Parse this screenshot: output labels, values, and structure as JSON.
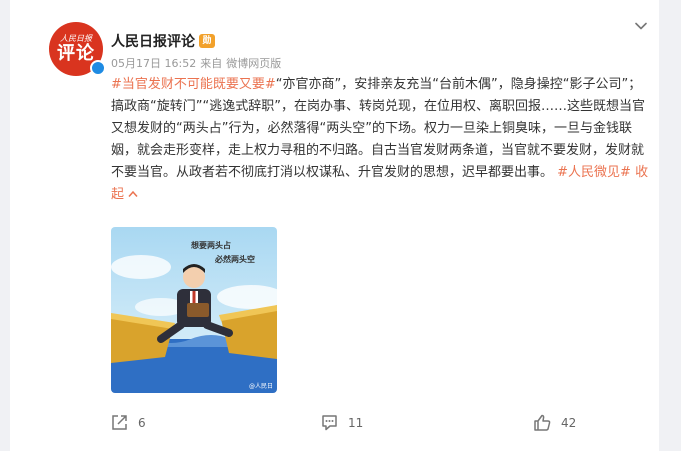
{
  "post": {
    "author": "人民日报评论",
    "avatar_small": "人民日报",
    "avatar_big": "评论",
    "medal": "勋",
    "date": "05月17日 16:52",
    "source_prefix": "来自",
    "source": "微博网页版",
    "hashtag": "#当官发财不可能既要又要#",
    "body": "“亦官亦商”，安排亲友充当“台前木偶”，隐身操控“影子公司”；搞政商“旋转门”“逃逸式辞职”，在岗办事、转岗兑现，在位用权、离职回报……这些既想当官又想发财的“两头占”行为，必然落得“两头空”的下场。权力一旦染上铜臭味，一旦与金钱联姻，就会走形变样，走上权力寻租的不归路。自古当官发财两条道，当官就不要发财，发财就不要当官。从政者若不彻底打消以权谋私、升官发财的思想，迟早都要出事。",
    "tail_tag": "#人民微见#",
    "collapse": "收起",
    "image": {
      "caption1": "想要两头占",
      "caption2": "必然两头空",
      "watermark": "@人民日"
    }
  },
  "actions": {
    "share_count": "6",
    "comment_count": "11",
    "like_count": "42"
  },
  "colors": {
    "accent": "#eb7350",
    "avatar_bg": "#d9341f",
    "verified": "#1e8be3"
  }
}
